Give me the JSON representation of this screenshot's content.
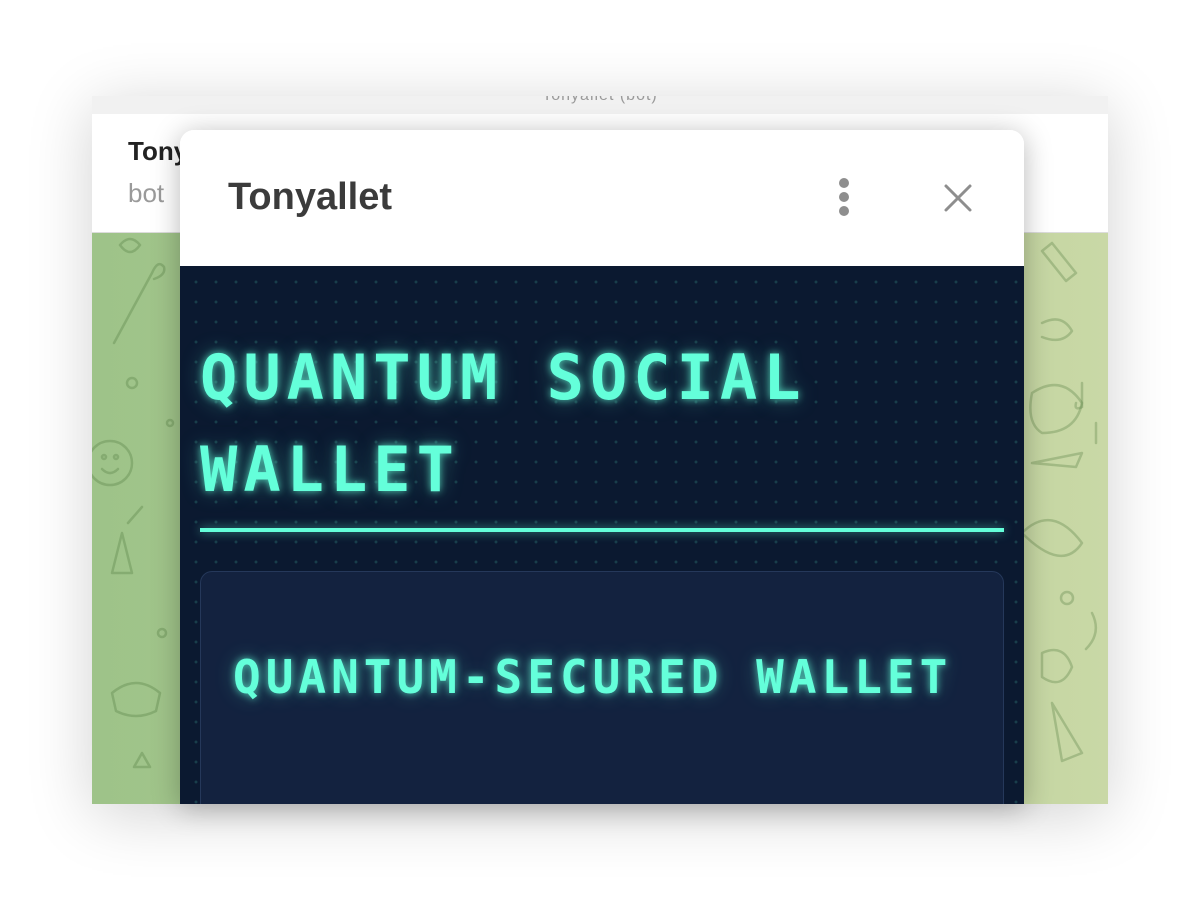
{
  "window": {
    "title": "Tonyallet (bot)"
  },
  "chat": {
    "name": "Tonyallet",
    "status": "bot"
  },
  "modal": {
    "title": "Tonyallet",
    "menu_icon": "vertical-dots-icon",
    "close_icon": "close-icon"
  },
  "webapp": {
    "heading": "QUANTUM SOCIAL WALLET",
    "card_heading": "QUANTUM-SECURED WALLET",
    "accent_color": "#64ffda",
    "background_color": "#0b1930",
    "card_color": "#13223f"
  }
}
